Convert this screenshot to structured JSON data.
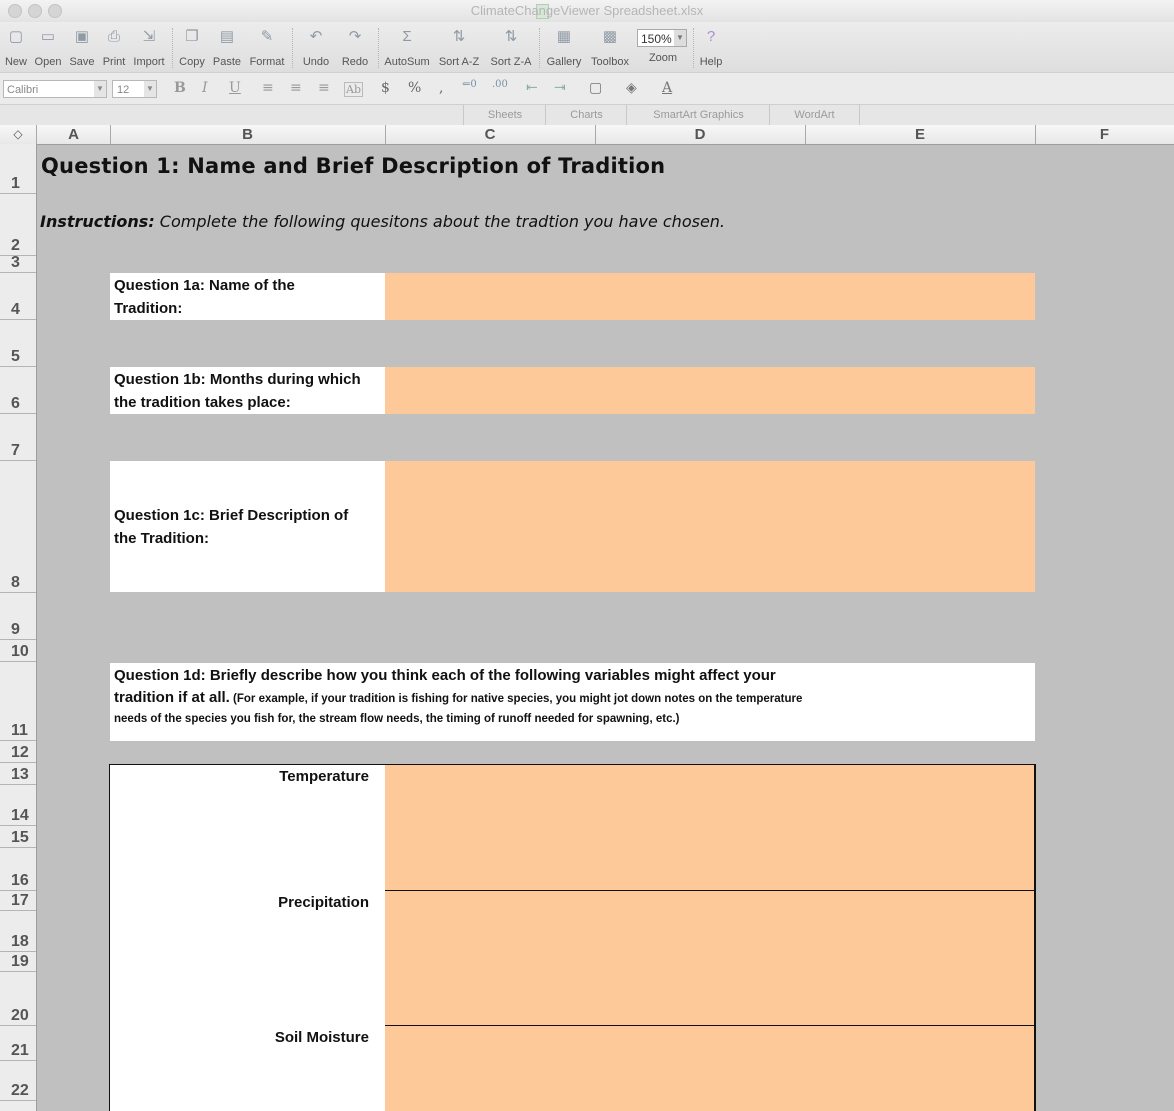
{
  "window": {
    "title": "ClimateChangeViewer Spreadsheet.xlsx"
  },
  "toolbar": {
    "new": "New",
    "open": "Open",
    "save": "Save",
    "print": "Print",
    "import": "Import",
    "copy": "Copy",
    "paste": "Paste",
    "format": "Format",
    "undo": "Undo",
    "redo": "Redo",
    "autosum": "AutoSum",
    "sort_az": "Sort A-Z",
    "sort_za": "Sort Z-A",
    "gallery": "Gallery",
    "toolbox": "Toolbox",
    "zoom_value": "150%",
    "zoom": "Zoom",
    "help": "Help"
  },
  "formatbar": {
    "font_name": "Calibri",
    "font_size": "12"
  },
  "ribbon": {
    "tabs": [
      "Sheets",
      "Charts",
      "SmartArt Graphics",
      "WordArt"
    ]
  },
  "columns": [
    "A",
    "B",
    "C",
    "D",
    "E",
    "F"
  ],
  "rows": [
    "1",
    "2",
    "3",
    "4",
    "5",
    "6",
    "7",
    "8",
    "9",
    "10",
    "11",
    "12",
    "13",
    "14",
    "15",
    "16",
    "17",
    "18",
    "19",
    "20",
    "21",
    "22"
  ],
  "sheet": {
    "title": "Question 1: Name and Brief Description of Tradition",
    "instructions_label": "Instructions:",
    "instructions_text": " Complete the following quesitons about the tradtion you have chosen.",
    "q1a": {
      "line1": "Question 1a: Name of the",
      "line2": "Tradition:"
    },
    "q1b": {
      "line1": "Question 1b: Months during which",
      "line2": "the tradition takes place:"
    },
    "q1c": {
      "line1": "Question 1c: Brief Description of",
      "line2": "the Tradition:"
    },
    "q1d": {
      "line1": "Question 1d: Briefly describe how you think each of the following variables might affect your",
      "line2_bold": "tradition if at all.",
      "line2_small": " (For example, if your tradition is fishing for native species, you might jot down notes on the temperature",
      "line3_small": "needs of the species you fish for, the stream flow needs, the timing of runoff needed for spawning, etc.)"
    },
    "variables": [
      "Temperature",
      "Precipitation",
      "Soil Moisture"
    ]
  }
}
